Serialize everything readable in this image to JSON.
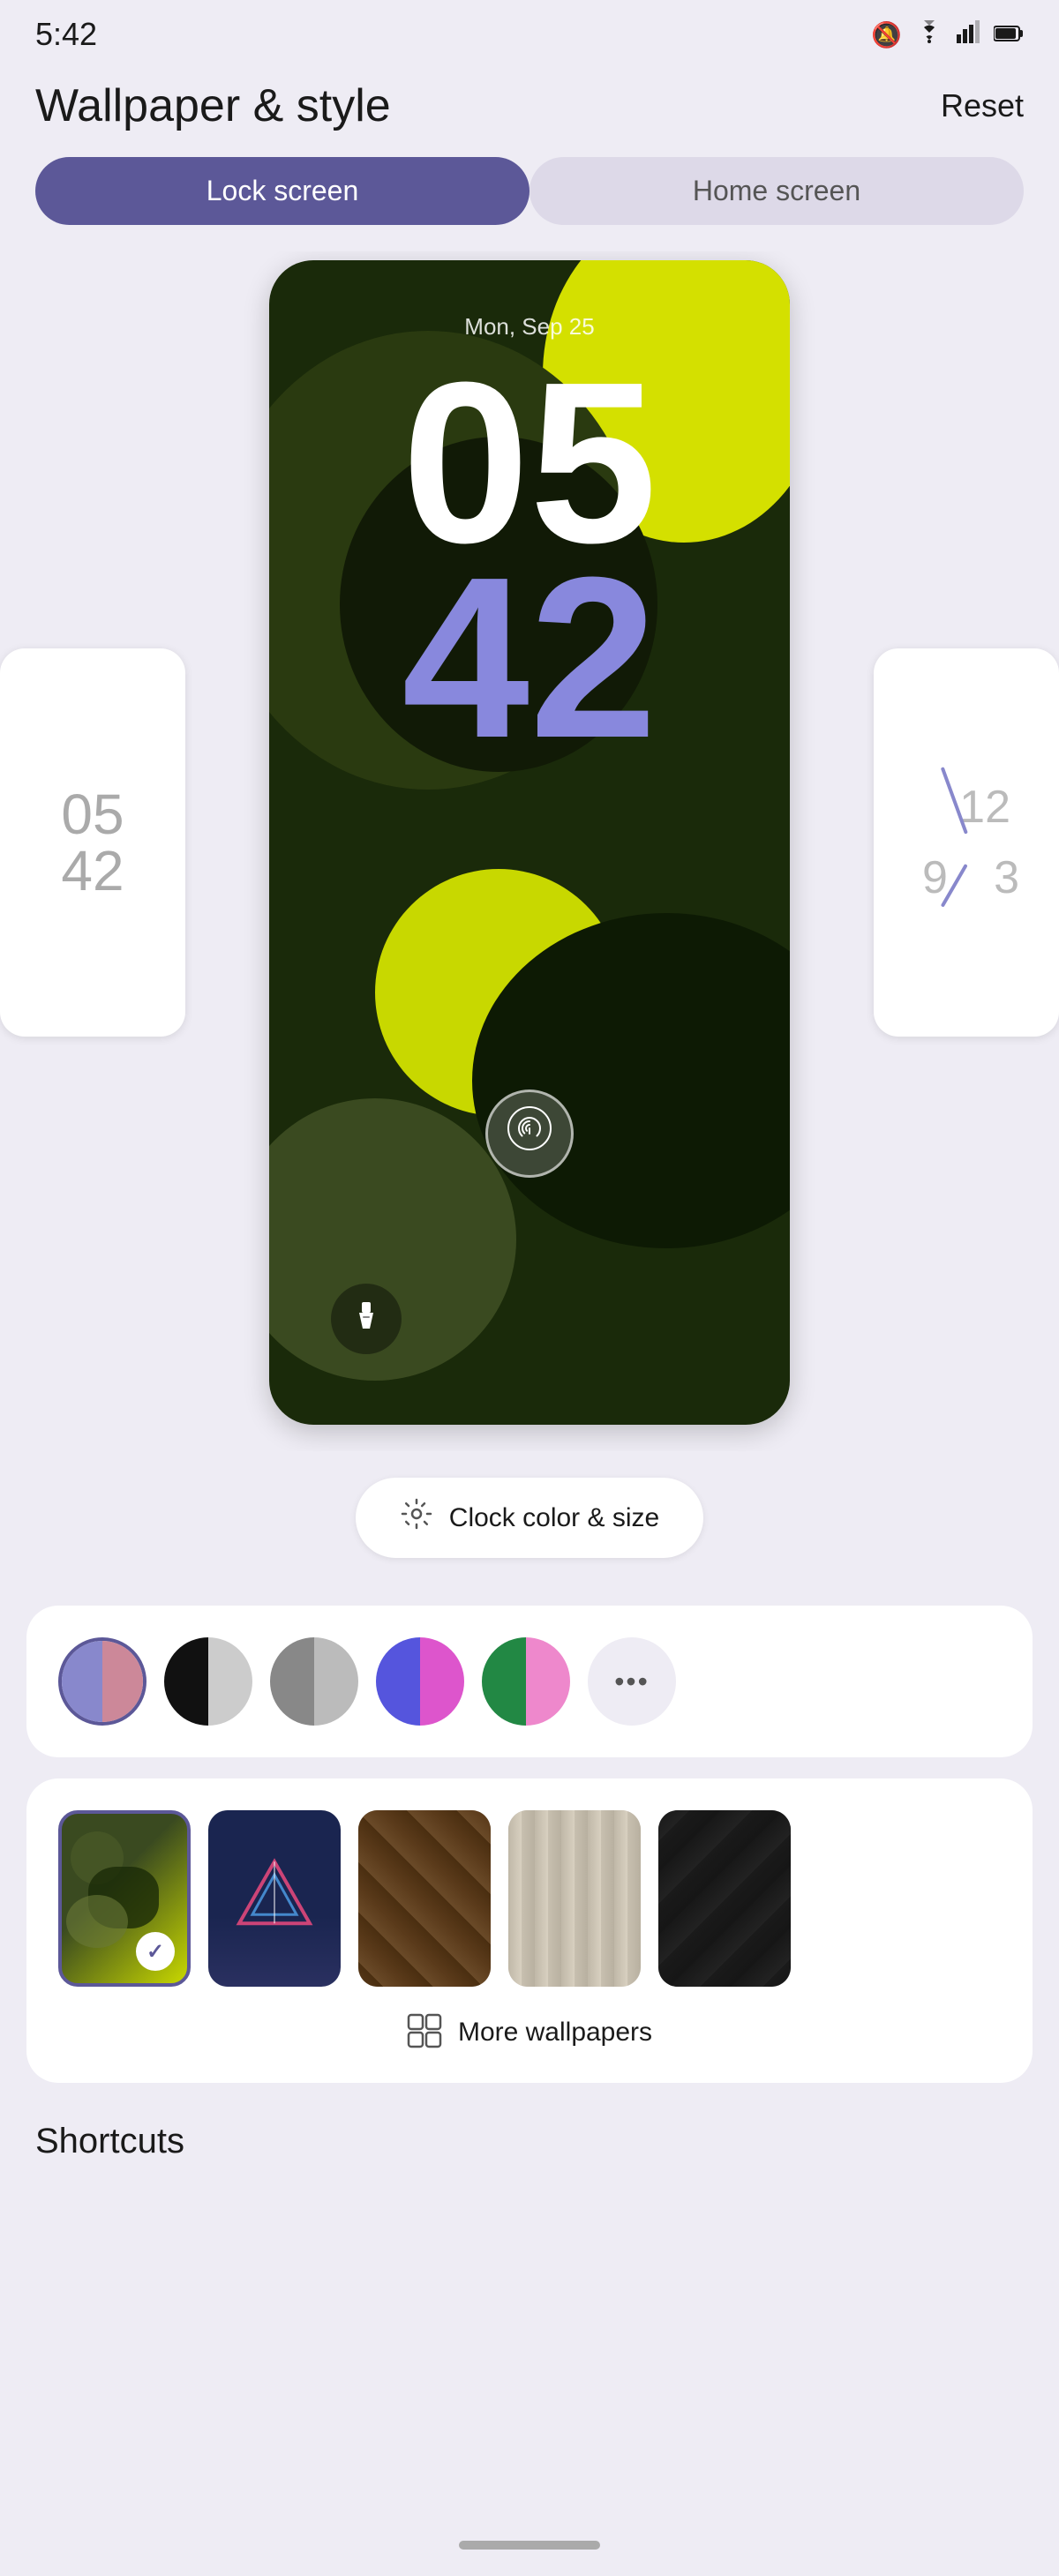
{
  "status": {
    "time": "5:42",
    "mute_icon": "🔕",
    "wifi_icon": "wifi",
    "signal_icon": "signal",
    "battery_icon": "battery"
  },
  "header": {
    "title": "Wallpaper & style",
    "reset_label": "Reset"
  },
  "tabs": {
    "lock_screen": "Lock screen",
    "home_screen": "Home screen"
  },
  "phone_preview": {
    "date": "Mon, Sep 25",
    "clock_hour": "05",
    "clock_min": "42"
  },
  "clock_color_btn_label": "Clock color & size",
  "palette": {
    "swatches": [
      {
        "id": 1,
        "left": "#8888cc",
        "right": "#cc8899",
        "selected": true
      },
      {
        "id": 2,
        "left": "#111",
        "right": "#ccc"
      },
      {
        "id": 3,
        "left": "#888",
        "right": "#bbb"
      },
      {
        "id": 4,
        "left": "#5555dd",
        "right": "#dd55bb"
      },
      {
        "id": 5,
        "left": "#228844",
        "right": "#ee88cc"
      }
    ],
    "more_label": "···"
  },
  "wallpapers": {
    "items": [
      {
        "id": 1,
        "selected": true
      },
      {
        "id": 2
      },
      {
        "id": 3
      },
      {
        "id": 4
      },
      {
        "id": 5
      }
    ],
    "more_label": "More wallpapers"
  },
  "shortcuts": {
    "label": "Shortcuts"
  }
}
